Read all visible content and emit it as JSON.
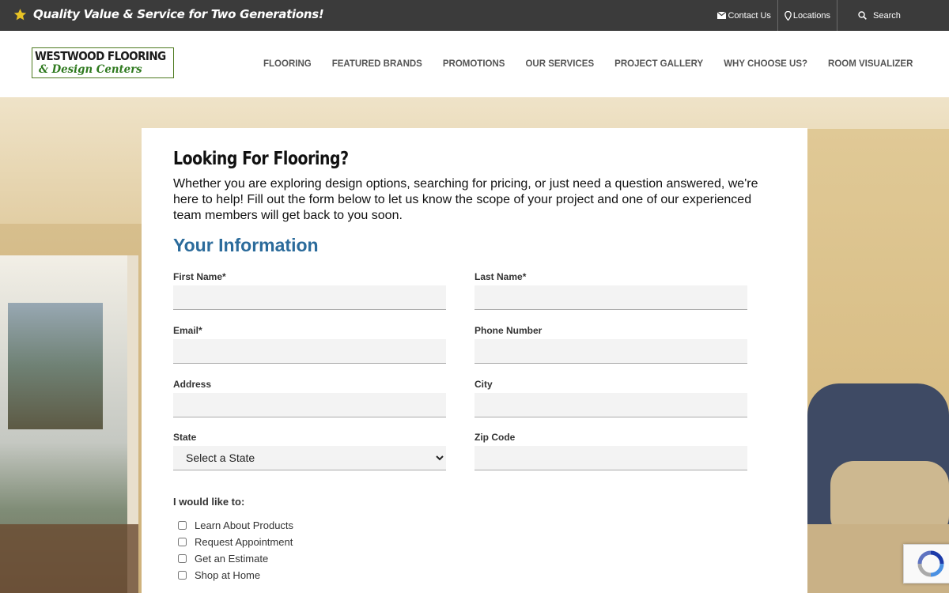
{
  "topbar": {
    "tagline": "Quality Value & Service for Two Generations!",
    "contact": "Contact Us",
    "locations": "Locations",
    "search": "Search"
  },
  "logo": {
    "line1": "WESTWOOD FLOORING",
    "line2": "& Design Centers"
  },
  "nav": {
    "items": [
      "FLOORING",
      "FEATURED BRANDS",
      "PROMOTIONS",
      "OUR SERVICES",
      "PROJECT GALLERY",
      "WHY CHOOSE US?",
      "ROOM VISUALIZER"
    ]
  },
  "form": {
    "title": "Looking For Flooring?",
    "intro": "Whether you are exploring design options, searching for pricing, or just need a question answered, we're here to help! Fill out the form below to let us know the scope of your project and one of our experienced team members will get back to you soon.",
    "section": "Your Information",
    "fields": {
      "first_name": {
        "label": "First Name*",
        "value": ""
      },
      "last_name": {
        "label": "Last Name*",
        "value": ""
      },
      "email": {
        "label": "Email*",
        "value": ""
      },
      "phone": {
        "label": "Phone Number",
        "value": ""
      },
      "address": {
        "label": "Address",
        "value": ""
      },
      "city": {
        "label": "City",
        "value": ""
      },
      "state": {
        "label": "State",
        "selected": "Select a State"
      },
      "zip": {
        "label": "Zip Code",
        "value": ""
      }
    },
    "wish_title": "I would like to:",
    "options": [
      {
        "label": "Learn About Products",
        "checked": false
      },
      {
        "label": "Request Appointment",
        "checked": false
      },
      {
        "label": "Get an Estimate",
        "checked": false
      },
      {
        "label": "Shop at Home",
        "checked": false
      }
    ]
  },
  "colors": {
    "topbar_bg": "#3b3b3b",
    "star": "#e8c325",
    "section_title": "#2b6b9b",
    "logo_green": "#2f7a1f"
  },
  "icons": {
    "tagline": "star-icon",
    "contact": "envelope-icon",
    "locations": "map-pin-icon",
    "search": "search-icon",
    "recaptcha": "recaptcha-icon"
  }
}
